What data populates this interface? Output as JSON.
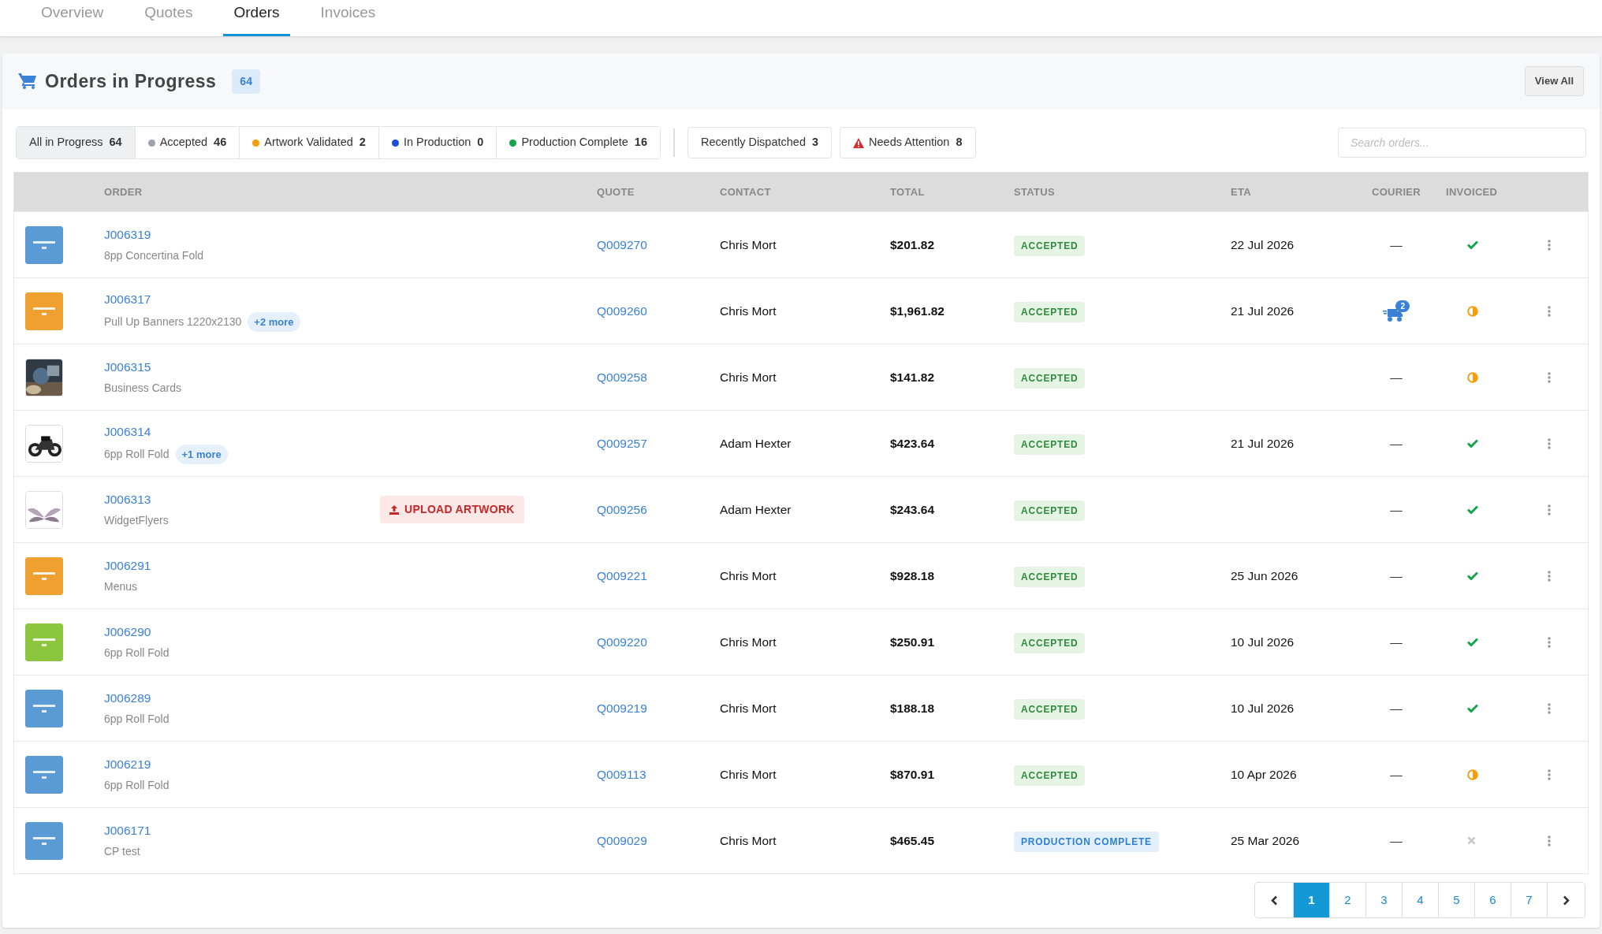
{
  "tabs": [
    {
      "label": "Overview",
      "selected": false
    },
    {
      "label": "Quotes",
      "selected": false
    },
    {
      "label": "Orders",
      "selected": true
    },
    {
      "label": "Invoices",
      "selected": false
    }
  ],
  "panel": {
    "title": "Orders in Progress",
    "count": "64",
    "view_all": "View All"
  },
  "filters": [
    {
      "label": "All in Progress",
      "count": "64",
      "selected": true,
      "kind": "plain"
    },
    {
      "label": "Accepted",
      "count": "46",
      "selected": false,
      "kind": "dot",
      "color": "#9ca3af"
    },
    {
      "label": "Artwork Validated",
      "count": "2",
      "selected": false,
      "kind": "dot",
      "color": "#f59e0b"
    },
    {
      "label": "In Production",
      "count": "0",
      "selected": false,
      "kind": "dot",
      "color": "#1d4ed8"
    },
    {
      "label": "Production Complete",
      "count": "16",
      "selected": false,
      "kind": "dot",
      "color": "#16a34a"
    }
  ],
  "extra_filters": [
    {
      "label": "Recently Dispatched",
      "count": "3",
      "selected": false,
      "kind": "plain"
    },
    {
      "label": "Needs Attention",
      "count": "8",
      "selected": false,
      "kind": "warning"
    }
  ],
  "search": {
    "placeholder": "Search orders..."
  },
  "table": {
    "columns": [
      "ORDER",
      "QUOTE",
      "CONTACT",
      "TOTAL",
      "STATUS",
      "ETA",
      "COURIER",
      "INVOICED"
    ],
    "rows": [
      {
        "order": "J006319",
        "product": "8pp Concertina Fold",
        "quote": "Q009270",
        "contact": "Chris Mort",
        "total": "$201.82",
        "status": {
          "kind": "accepted",
          "text": "ACCEPTED"
        },
        "eta": "22 Jul 2026",
        "courier": {
          "kind": "none",
          "text": "—"
        },
        "invoiced": {
          "kind": "paid"
        }
      },
      {
        "order": "J006317",
        "product": "Pull Up Banners 1220x2130",
        "more": "+2 more",
        "quote": "Q009260",
        "contact": "Chris Mort",
        "total": "$1,961.82",
        "status": {
          "kind": "accepted",
          "text": "ACCEPTED"
        },
        "eta": "21 Jul 2026",
        "courier": {
          "kind": "truck",
          "count": "2"
        },
        "invoiced": {
          "kind": "partial"
        }
      },
      {
        "order": "J006315",
        "product": "Business Cards",
        "quote": "Q009258",
        "contact": "Chris Mort",
        "total": "$141.82",
        "status": {
          "kind": "accepted",
          "text": "ACCEPTED"
        },
        "courier": {
          "kind": "none",
          "text": "—"
        },
        "invoiced": {
          "kind": "partial"
        }
      },
      {
        "order": "J006314",
        "product": "6pp Roll Fold",
        "more": "+1 more",
        "quote": "Q009257",
        "contact": "Adam Hexter",
        "total": "$423.64",
        "status": {
          "kind": "accepted",
          "text": "ACCEPTED"
        },
        "eta": "21 Jul 2026",
        "courier": {
          "kind": "none",
          "text": "—"
        },
        "invoiced": {
          "kind": "paid"
        }
      },
      {
        "order": "J006313",
        "product": "WidgetFlyers",
        "upload": "UPLOAD ARTWORK",
        "quote": "Q009256",
        "contact": "Adam Hexter",
        "total": "$243.64",
        "status": {
          "kind": "accepted",
          "text": "ACCEPTED"
        },
        "courier": {
          "kind": "none",
          "text": "—"
        },
        "invoiced": {
          "kind": "paid"
        }
      },
      {
        "order": "J006291",
        "product": "Menus",
        "quote": "Q009221",
        "contact": "Chris Mort",
        "total": "$928.18",
        "status": {
          "kind": "accepted",
          "text": "ACCEPTED"
        },
        "eta": "25 Jun 2026",
        "courier": {
          "kind": "none",
          "text": "—"
        },
        "invoiced": {
          "kind": "paid"
        }
      },
      {
        "order": "J006290",
        "product": "6pp Roll Fold",
        "quote": "Q009220",
        "contact": "Chris Mort",
        "total": "$250.91",
        "status": {
          "kind": "accepted",
          "text": "ACCEPTED"
        },
        "eta": "10 Jul 2026",
        "courier": {
          "kind": "none",
          "text": "—"
        },
        "invoiced": {
          "kind": "paid"
        }
      },
      {
        "order": "J006289",
        "product": "6pp Roll Fold",
        "quote": "Q009219",
        "contact": "Chris Mort",
        "total": "$188.18",
        "status": {
          "kind": "accepted",
          "text": "ACCEPTED"
        },
        "eta": "10 Jul 2026",
        "courier": {
          "kind": "none",
          "text": "—"
        },
        "invoiced": {
          "kind": "paid"
        }
      },
      {
        "order": "J006219",
        "product": "6pp Roll Fold",
        "quote": "Q009113",
        "contact": "Chris Mort",
        "total": "$870.91",
        "status": {
          "kind": "accepted",
          "text": "ACCEPTED"
        },
        "eta": "10 Apr 2026",
        "courier": {
          "kind": "none",
          "text": "—"
        },
        "invoiced": {
          "kind": "partial"
        }
      },
      {
        "order": "J006171",
        "product": "CP test",
        "quote": "Q009029",
        "contact": "Chris Mort",
        "total": "$465.45",
        "status": {
          "kind": "complete",
          "text": "PRODUCTION COMPLETE"
        },
        "eta": "25 Mar 2026",
        "courier": {
          "kind": "none",
          "text": "—"
        },
        "invoiced": {
          "kind": "none"
        }
      }
    ]
  },
  "pagination": {
    "pages": [
      {
        "label": "1",
        "selected": true
      },
      {
        "label": "2",
        "selected": false
      },
      {
        "label": "3",
        "selected": false
      },
      {
        "label": "4",
        "selected": false
      },
      {
        "label": "5",
        "selected": false
      },
      {
        "label": "6",
        "selected": false
      },
      {
        "label": "7",
        "selected": false
      }
    ]
  }
}
